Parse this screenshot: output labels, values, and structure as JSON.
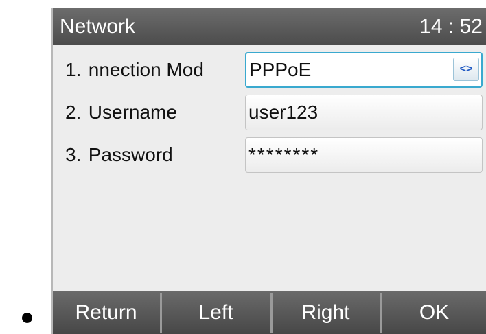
{
  "header": {
    "title": "Network",
    "time": "14 : 52"
  },
  "rows": [
    {
      "index": "1.",
      "label": "nnection Mod",
      "value": "PPPoE",
      "switch_glyph": "<>"
    },
    {
      "index": "2.",
      "label": "Username",
      "value": "user123"
    },
    {
      "index": "3.",
      "label": "Password",
      "value": "********"
    }
  ],
  "softkeys": {
    "return": "Return",
    "left": "Left",
    "right": "Right",
    "ok": "OK"
  },
  "colors": {
    "focus_border": "#3aa9cf",
    "switch_arrows": "#1b56c2",
    "bar_background": "#555555"
  }
}
